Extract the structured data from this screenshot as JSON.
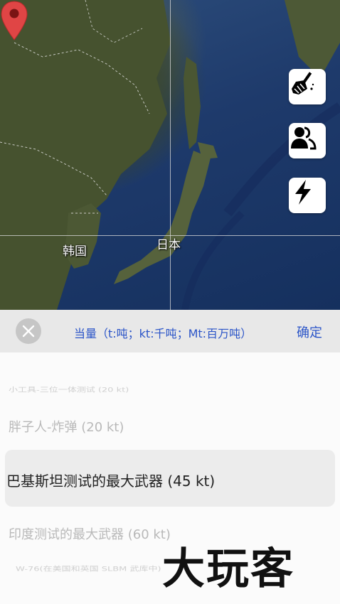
{
  "map": {
    "labels": {
      "korea": "韩国",
      "japan": "日本"
    }
  },
  "tools": [
    {
      "icon": "broom-icon"
    },
    {
      "icon": "people-icon"
    },
    {
      "icon": "lightning-icon"
    }
  ],
  "picker": {
    "title": "当量（t:吨；kt:千吨；Mt:百万吨）",
    "confirm_label": "确定",
    "items": [
      "小工具-三位一体测试 (20 kt)",
      "胖子人-炸弹 (20 kt)",
      "巴基斯坦测试的最大武器 (45 kt)",
      "印度测试的最大武器 (60 kt)",
      "W-76(在美国和英国 SLBM 武库中)"
    ],
    "selected_index": 2
  },
  "watermark": "大玩客"
}
